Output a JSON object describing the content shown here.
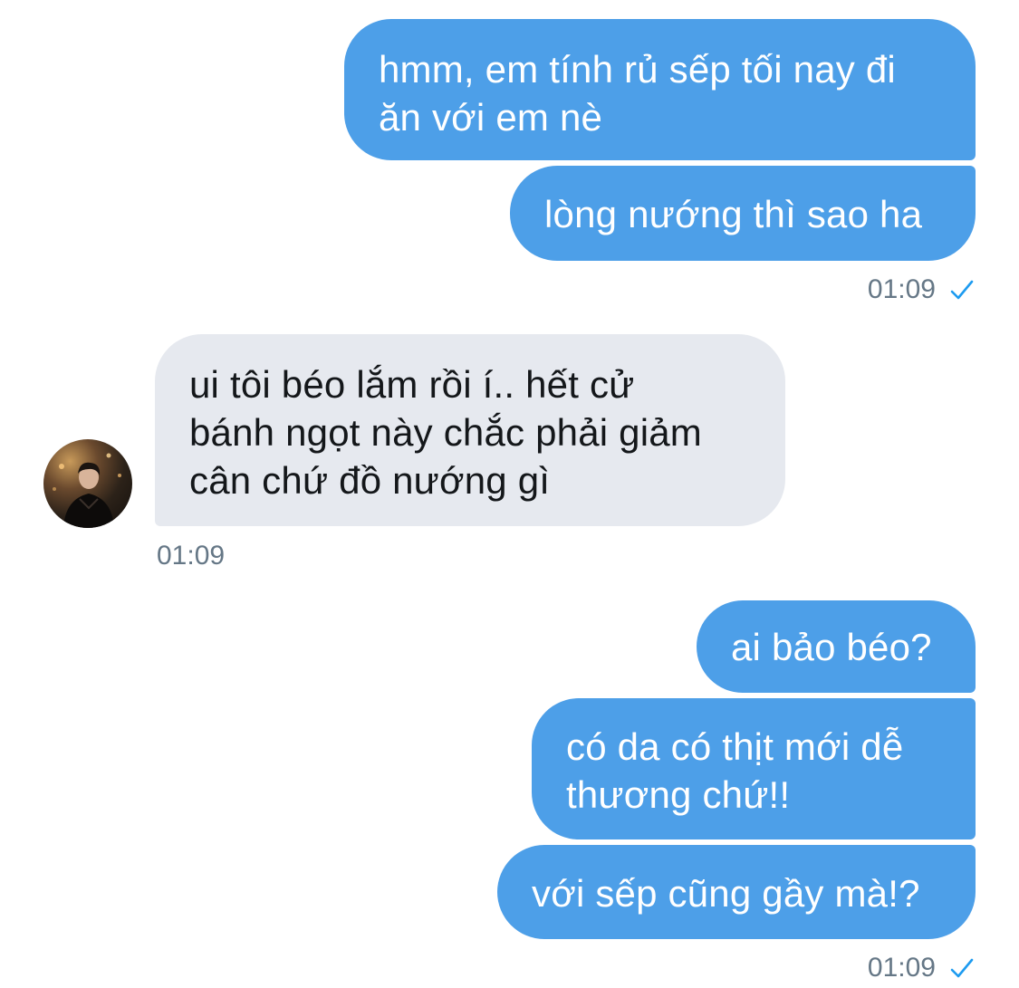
{
  "conversation": {
    "group1": {
      "messages": [
        "hmm, em tính rủ sếp tối nay đi\năn với em nè",
        "lòng nướng thì sao ha"
      ],
      "time": "01:09",
      "status_icon": "check-icon"
    },
    "group2": {
      "message": "ui tôi béo lắm rồi í.. hết cử\nbánh ngọt này chắc phải giảm\ncân chứ đồ nướng gì",
      "time": "01:09",
      "avatar_icon": "avatar-photo"
    },
    "group3": {
      "messages": [
        "ai bảo béo?",
        "có da có thịt mới dễ\nthương chứ!!",
        "với sếp cũng gầy mà!?"
      ],
      "time": "01:09",
      "status_icon": "check-icon"
    }
  },
  "colors": {
    "outgoing_bubble": "#4d9fe8",
    "incoming_bubble": "#e6e9ef",
    "timestamp": "#657786",
    "check": "#1d9bf0"
  }
}
